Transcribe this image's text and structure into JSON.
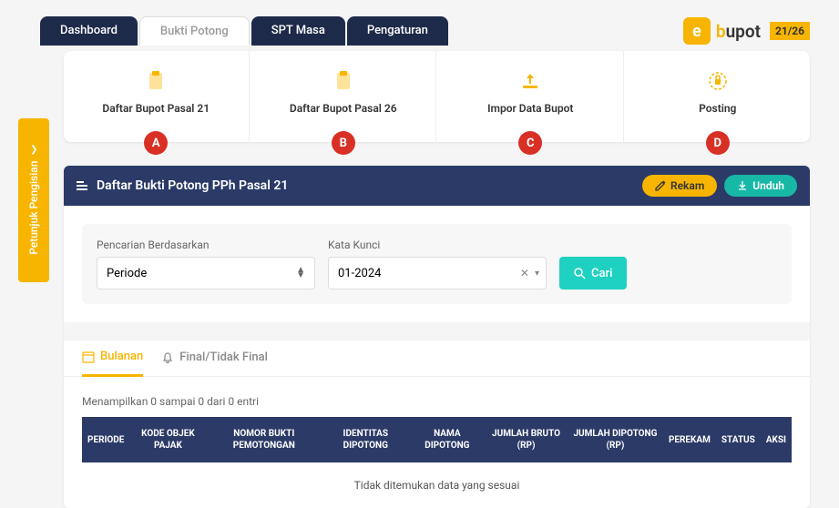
{
  "brand": {
    "name_prefix": "b",
    "name_rest": "upot",
    "badge": "21/26"
  },
  "tabs": [
    "Dashboard",
    "Bukti Potong",
    "SPT Masa",
    "Pengaturan"
  ],
  "side_tab": "Petunjuk Pengisian",
  "cards": [
    {
      "title": "Daftar Bupot Pasal 21",
      "letter": "A"
    },
    {
      "title": "Daftar Bupot Pasal 26",
      "letter": "B"
    },
    {
      "title": "Impor Data Bupot",
      "letter": "C"
    },
    {
      "title": "Posting",
      "letter": "D"
    }
  ],
  "panel": {
    "title": "Daftar Bukti Potong PPh Pasal 21",
    "rekam": "Rekam",
    "unduh": "Unduh"
  },
  "search": {
    "label1": "Pencarian Berdasarkan",
    "select_value": "Periode",
    "label2": "Kata Kunci",
    "input_value": "01-2024",
    "cari": "Cari"
  },
  "subtabs": {
    "bulanan": "Bulanan",
    "final": "Final/Tidak Final"
  },
  "table": {
    "info": "Menampilkan 0 sampai 0 dari 0 entri",
    "headers": [
      "PERIODE",
      "KODE OBJEK PAJAK",
      "NOMOR BUKTI PEMOTONGAN",
      "IDENTITAS DIPOTONG",
      "NAMA DIPOTONG",
      "JUMLAH BRUTO (RP)",
      "JUMLAH DIPOTONG (RP)",
      "PEREKAM",
      "STATUS",
      "AKSI"
    ],
    "empty": "Tidak ditemukan data yang sesuai"
  }
}
